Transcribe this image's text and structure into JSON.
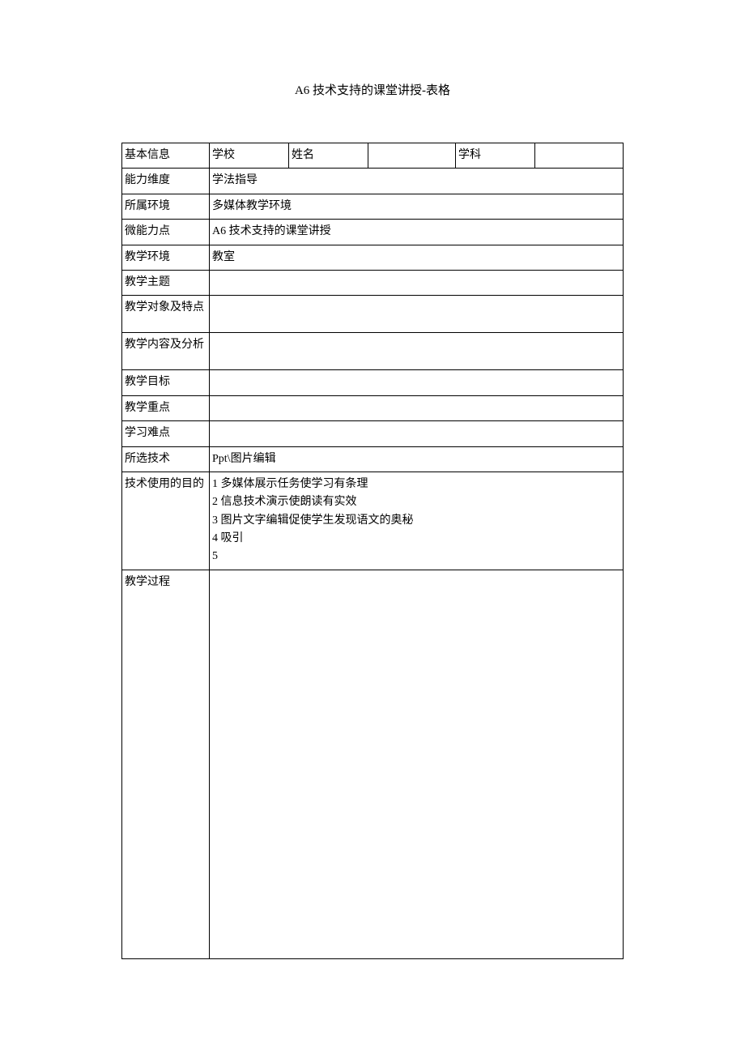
{
  "title": "A6 技术支持的课堂讲授-表格",
  "rows": {
    "basic_info": {
      "label": "基本信息",
      "school_label": "学校",
      "school_value": "",
      "name_label": "姓名",
      "name_value": "",
      "subject_label": "学科",
      "subject_value": ""
    },
    "ability_dimension": {
      "label": "能力维度",
      "value": "学法指导"
    },
    "environment": {
      "label": "所属环境",
      "value": "多媒体教学环境"
    },
    "micro_ability": {
      "label": "微能力点",
      "value": "A6 技术支持的课堂讲授"
    },
    "teaching_env": {
      "label": "教学环境",
      "value": "教室"
    },
    "teaching_topic": {
      "label": "教学主题",
      "value": ""
    },
    "teaching_target": {
      "label": "教学对象及特点",
      "value": ""
    },
    "teaching_content": {
      "label": "教学内容及分析",
      "value": ""
    },
    "teaching_goal": {
      "label": "教学目标",
      "value": ""
    },
    "teaching_focus": {
      "label": "教学重点",
      "value": ""
    },
    "learning_difficulty": {
      "label": "学习难点",
      "value": ""
    },
    "selected_tech": {
      "label": "所选技术",
      "value": "Ppt\\图片编辑"
    },
    "tech_purpose": {
      "label": "技术使用的目的",
      "value": "1 多媒体展示任务使学习有条理\n2 信息技术演示使朗读有实效\n3 图片文字编辑促使学生发现语文的奥秘\n4 吸引\n5"
    },
    "teaching_process": {
      "label": "教学过程",
      "value": ""
    }
  }
}
